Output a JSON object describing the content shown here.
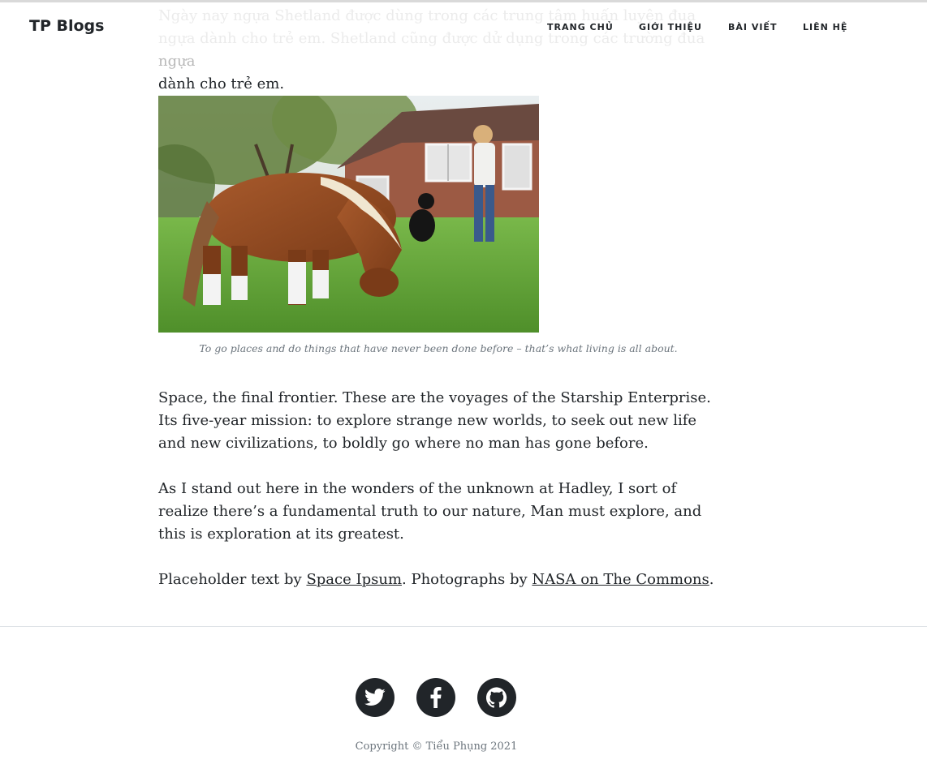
{
  "navbar": {
    "brand": "TP Blogs",
    "links": [
      "TRANG CHỦ",
      "GIỚI THIỆU",
      "BÀI VIẾT",
      "LIÊN HỆ"
    ]
  },
  "article": {
    "intro_faded": "Ngày nay ngựa Shetland được dùng trong các trung tâm huấn luyện đua ngựa dành cho trẻ em. Shetland cũng được dử dụng trong các trường đua ngựa",
    "intro_tail": "dành cho trẻ em.",
    "caption": "To go places and do things that have never been done before – that’s what living is all about.",
    "paragraphs": [
      "Space, the final frontier. These are the voyages of the Starship Enterprise. Its five-year mission: to explore strange new worlds, to seek out new life and new civilizations, to boldly go where no man has gone before.",
      "As I stand out here in the wonders of the unknown at Hadley, I sort of realize there’s a fundamental truth to our nature, Man must explore, and this is exploration at its greatest."
    ],
    "credits": {
      "prefix": "Placeholder text by ",
      "link1": "Space Ipsum",
      "middle": ". Photographs by ",
      "link2": "NASA on The Commons",
      "suffix": "."
    }
  },
  "footer": {
    "social_icons": [
      "twitter-icon",
      "facebook-icon",
      "github-icon"
    ],
    "copyright": "Copyright © Tiểu Phụng 2021"
  },
  "colors": {
    "text": "#212529",
    "muted": "#6c757d",
    "social_bg": "#212529"
  }
}
